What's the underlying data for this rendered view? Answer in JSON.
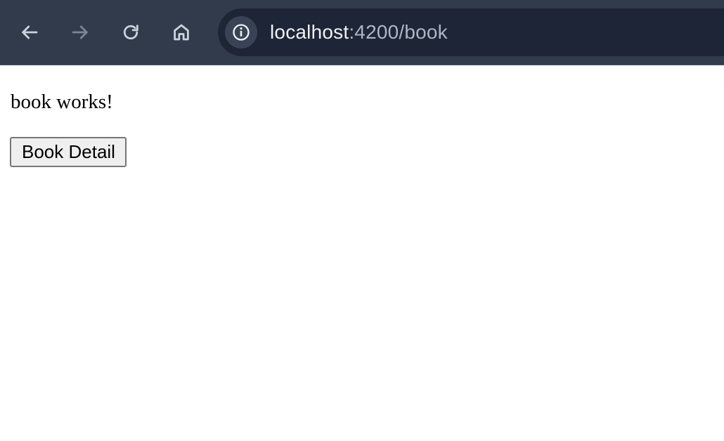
{
  "browser": {
    "nav": {
      "back_icon": "arrow-left-icon",
      "forward_icon": "arrow-right-icon",
      "forward_enabled": false,
      "reload_icon": "reload-icon",
      "home_icon": "home-icon"
    },
    "address_bar": {
      "site_info_icon": "info-icon",
      "url_host": "localhost",
      "url_path": ":4200/book"
    },
    "colors": {
      "toolbar": "#323b4c",
      "omnibox": "#1e2536",
      "icon": "#cdd3de",
      "icon_disabled": "#7c8597"
    }
  },
  "page": {
    "heading_text": "book works!",
    "book_detail_button_label": "Book Detail"
  }
}
